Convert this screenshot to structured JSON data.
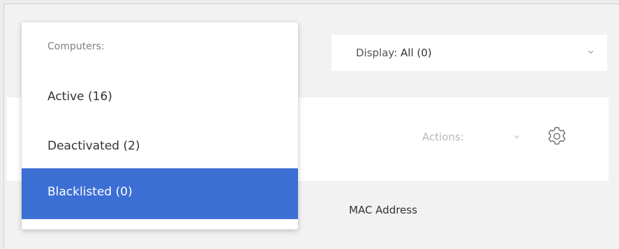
{
  "display_filter": {
    "label": "Display:",
    "value": "All (0)",
    "icon": "chevron-down-icon"
  },
  "toolbar": {
    "actions_label": "Actions:",
    "actions_icon": "chevron-down-icon",
    "settings_icon": "gear-icon"
  },
  "table": {
    "columns": [
      "MAC Address"
    ]
  },
  "computers_menu": {
    "header": "Computers:",
    "items": [
      {
        "label": "Active (16)",
        "selected": false
      },
      {
        "label": "Deactivated (2)",
        "selected": false
      },
      {
        "label": "Blacklisted (0)",
        "selected": true
      }
    ],
    "selected_color": "#3c6fd4"
  }
}
